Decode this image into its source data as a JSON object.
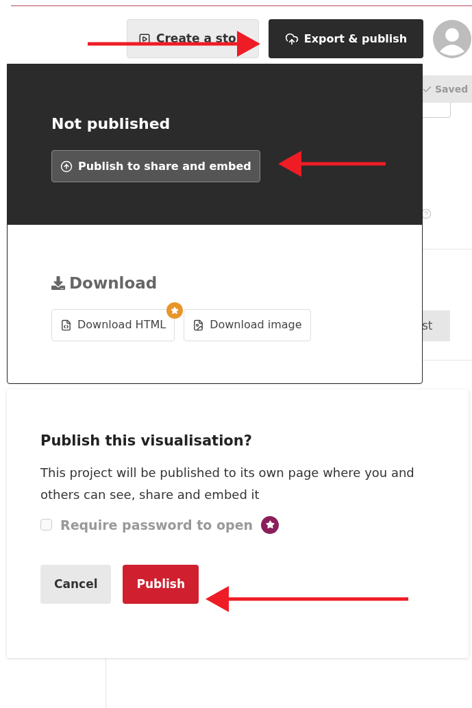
{
  "toolbar": {
    "create_button": "Create a sto",
    "export_button": "Export & publish"
  },
  "background": {
    "saved_button": "Saved",
    "partial_button": "st"
  },
  "export_menu": {
    "status_title": "Not published",
    "publish_button": "Publish to share and embed",
    "download_heading": "Download",
    "download_buttons": [
      {
        "label": "Download HTML",
        "kind": "html",
        "premium": true
      },
      {
        "label": "Download image",
        "kind": "image",
        "premium": false
      }
    ]
  },
  "dialog": {
    "title": "Publish this visualisation?",
    "message": "This project will be published to its own page where you and others can see, share and embed it",
    "password_option": {
      "label": "Require password to open",
      "checked": false,
      "disabled": true,
      "premium": true
    },
    "buttons": [
      {
        "label": "Cancel",
        "kind": "secondary"
      },
      {
        "label": "Publish",
        "kind": "primary"
      }
    ]
  }
}
